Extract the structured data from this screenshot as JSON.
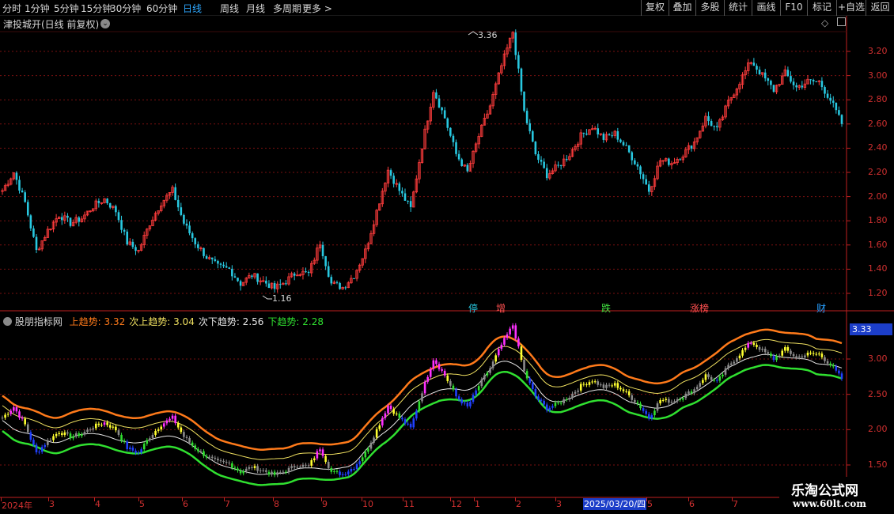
{
  "toolbar": {
    "periods": [
      "分时",
      "1分钟",
      "5分钟",
      "15分钟",
      "30分钟",
      "60分钟",
      "日线",
      "周线",
      "月线",
      "多周期",
      "更多 >"
    ],
    "active_period": "日线",
    "right_tools": [
      "复权",
      "叠加",
      "多股",
      "统计",
      "画线",
      "F10",
      "标记",
      "+自选",
      "返回"
    ]
  },
  "main_chart": {
    "caption": "津投城开(日线 前复权)",
    "high_marker": "3.36",
    "low_marker": "1.16",
    "y_ticks": [
      "3.20",
      "3.00",
      "2.80",
      "2.60",
      "2.40",
      "2.20",
      "2.00",
      "1.80",
      "1.60",
      "1.40",
      "1.20"
    ],
    "events": [
      {
        "label": "停",
        "color": "#28c8e0"
      },
      {
        "label": "增",
        "color": "#ff5050"
      },
      {
        "label": "跌",
        "color": "#40e040"
      },
      {
        "label": "涨榜",
        "color": "#ff5050"
      },
      {
        "label": "财",
        "color": "#28a0ff"
      }
    ]
  },
  "indicator": {
    "name": "股朋指标网",
    "lines": [
      {
        "label": "上趋势: 3.32",
        "color": "#ff7a1a"
      },
      {
        "label": "次上趋势: 3.04",
        "color": "#f0e060"
      },
      {
        "label": "次下趋势: 2.56",
        "color": "#e8e8e8"
      },
      {
        "label": "下趋势: 2.28",
        "color": "#30e030"
      }
    ],
    "y_ticks": [
      "3.00",
      "2.50",
      "2.00",
      "1.50"
    ],
    "current_value": "3.33"
  },
  "timeline": {
    "labels": [
      "2024年",
      "3",
      "4",
      "5",
      "6",
      "7",
      "8",
      "9",
      "10",
      "11",
      "12",
      "1",
      "2",
      "3",
      "5",
      "6",
      "7"
    ],
    "cursor_date": "2025/03/20/四"
  },
  "watermark": {
    "title": "乐淘公式网",
    "url": "www.60lt.com"
  },
  "colors": {
    "up": "#ff3c3c",
    "down": "#28c8e0",
    "grid": "#7a1010",
    "axis": "#c02020"
  },
  "chart_data": {
    "type": "line",
    "title": "津投城开(日线 前复权)",
    "ylim": [
      1.1,
      3.4
    ],
    "series": [
      {
        "values": [
          2.05,
          2.2,
          1.95,
          1.55,
          1.72,
          1.85,
          1.78,
          1.82,
          1.92,
          1.98,
          1.88,
          1.62,
          1.55,
          1.78,
          1.95,
          2.05,
          1.78,
          1.62,
          1.5,
          1.42,
          1.4,
          1.28,
          1.35,
          1.3,
          1.24,
          1.3,
          1.38,
          1.36,
          1.62,
          1.28,
          1.25,
          1.35,
          1.55,
          1.88,
          2.22,
          2.05,
          1.9,
          2.42,
          2.88,
          2.65,
          2.35,
          2.2,
          2.5,
          2.75,
          3.08,
          3.36,
          2.7,
          2.35,
          2.18,
          2.25,
          2.35,
          2.5,
          2.58,
          2.48,
          2.52,
          2.4,
          2.25,
          2.05,
          2.3,
          2.28,
          2.35,
          2.45,
          2.65,
          2.55,
          2.78,
          2.95,
          3.12,
          3.0,
          2.88,
          3.02,
          2.9,
          2.95,
          2.95,
          2.8,
          2.6
        ]
      }
    ]
  }
}
